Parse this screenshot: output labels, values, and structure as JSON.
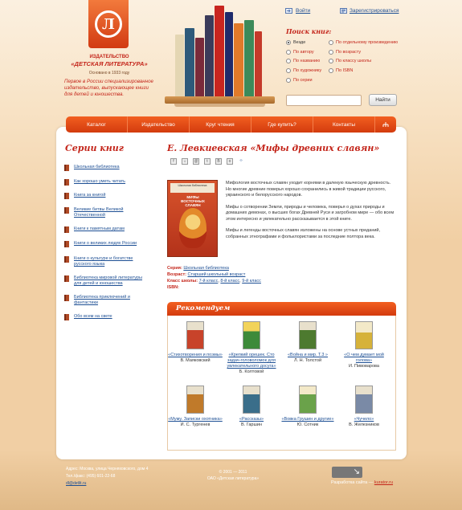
{
  "header": {
    "logo_letter": "Л",
    "publisher_label": "ИЗДАТЕЛЬСТВО",
    "publisher_name": "«ДЕТСКАЯ ЛИТЕРАТУРА»",
    "founded": "Основано в 1933 году",
    "tagline": "Первое в России специализированное издательство, выпускающее книги для детей и юношества."
  },
  "auth": {
    "login": "Войти",
    "register": "Зарегистрироваться"
  },
  "search": {
    "title": "Поиск книг:",
    "options": [
      {
        "label": "Везде",
        "checked": true
      },
      {
        "label": "По отдельному произведению",
        "checked": false
      },
      {
        "label": "По автору",
        "checked": false
      },
      {
        "label": "По возрасту",
        "checked": false
      },
      {
        "label": "По названию",
        "checked": false
      },
      {
        "label": "По классу школы",
        "checked": false
      },
      {
        "label": "По художнику",
        "checked": false
      },
      {
        "label": "По ISBN",
        "checked": false
      },
      {
        "label": "По серии",
        "checked": false
      }
    ],
    "input_value": "",
    "button": "Найти"
  },
  "nav": {
    "items": [
      "Каталог",
      "Издательство",
      "Круг чтения",
      "Где купить?",
      "Контакты"
    ]
  },
  "sidebar": {
    "title": "Серии книг",
    "items": [
      "Школьная библиотека",
      "Как хорошо уметь читать",
      "Книга за книгой",
      "Великие битвы Великой Отечественной",
      "Книги к памятным датам",
      "Книги о великих людях России",
      "Книги о культуре и богатстве русского языка",
      "Библиотека мировой литературы для детей и юношества",
      "Библиотека приключений и фантастики",
      "Обо всем на свете"
    ]
  },
  "book": {
    "title": "Е. Левкиевская «Мифы древних славян»",
    "cover_publisher": "Школьная библиотека",
    "cover_title": "МИФЫ ВОСТОЧНЫХ СЛАВЯН",
    "description": [
      "Мифология восточных славян уходит корнями в далекую языческую древность. Но многие древние поверья хорошо сохранились в живой традиции русского, украинского и белорусского народов.",
      "Мифы о сотворении Земли, природы и человека, поверья о духах природы и домашних демонах, о высших богах Древней Руси и загробном мире — обо всем этом интересно и увлекательно рассказывается в этой книге.",
      "Мифы и легенды восточных славян изложены на основе устных преданий, собранных этнографами и фольклористами за последние полтора века."
    ],
    "series_label": "Серия:",
    "series_value": "Школьная библиотека",
    "age_label": "Возраст:",
    "age_value": "Старший школьный возраст",
    "class_label": "Класс школы:",
    "class_values": [
      "7-й класс",
      "8-й класс",
      "9-й класс"
    ],
    "isbn_label": "ISBN:"
  },
  "recommend": {
    "title": "Рекомендуем",
    "items": [
      {
        "title": "«Стихотворения и поэмы»",
        "author": "В. Маяковский",
        "color": "#c8432a"
      },
      {
        "title": "«Крепкий орешек. Сто задач-головоломок для увлекательного досуга»",
        "author": "Б. Колтовой",
        "color": "#3d8a3a"
      },
      {
        "title": "«Война и мир. Т.3 »",
        "author": "Л. Н. Толстой",
        "color": "#4d7a2f"
      },
      {
        "title": "«О чем думает мой голова»",
        "author": "И. Пивоварова",
        "color": "#d6b23a"
      },
      {
        "title": "«Муму. Записки охотника»",
        "author": "И. С. Тургенев",
        "color": "#c07a2a"
      },
      {
        "title": "«Рассказы»",
        "author": "В. Гаршин",
        "color": "#3a6e8a"
      },
      {
        "title": "«Вовка Грушин и другие»",
        "author": "Ю. Сотник",
        "color": "#6aa24a"
      },
      {
        "title": "«Чучело»",
        "author": "В. Железников",
        "color": "#7a8aa6"
      }
    ]
  },
  "footer": {
    "address": "Адрес: Москва, улица Черняховского, дом 4",
    "phone": "Тел./факс: (495) 601-22-68",
    "email": "dl@detlit.ru",
    "copyright": "© 2001 — 2011",
    "company": "ОАО «Детская литература»",
    "dev_label": "Разработка сайта —",
    "dev_name": "kurator.ru"
  }
}
